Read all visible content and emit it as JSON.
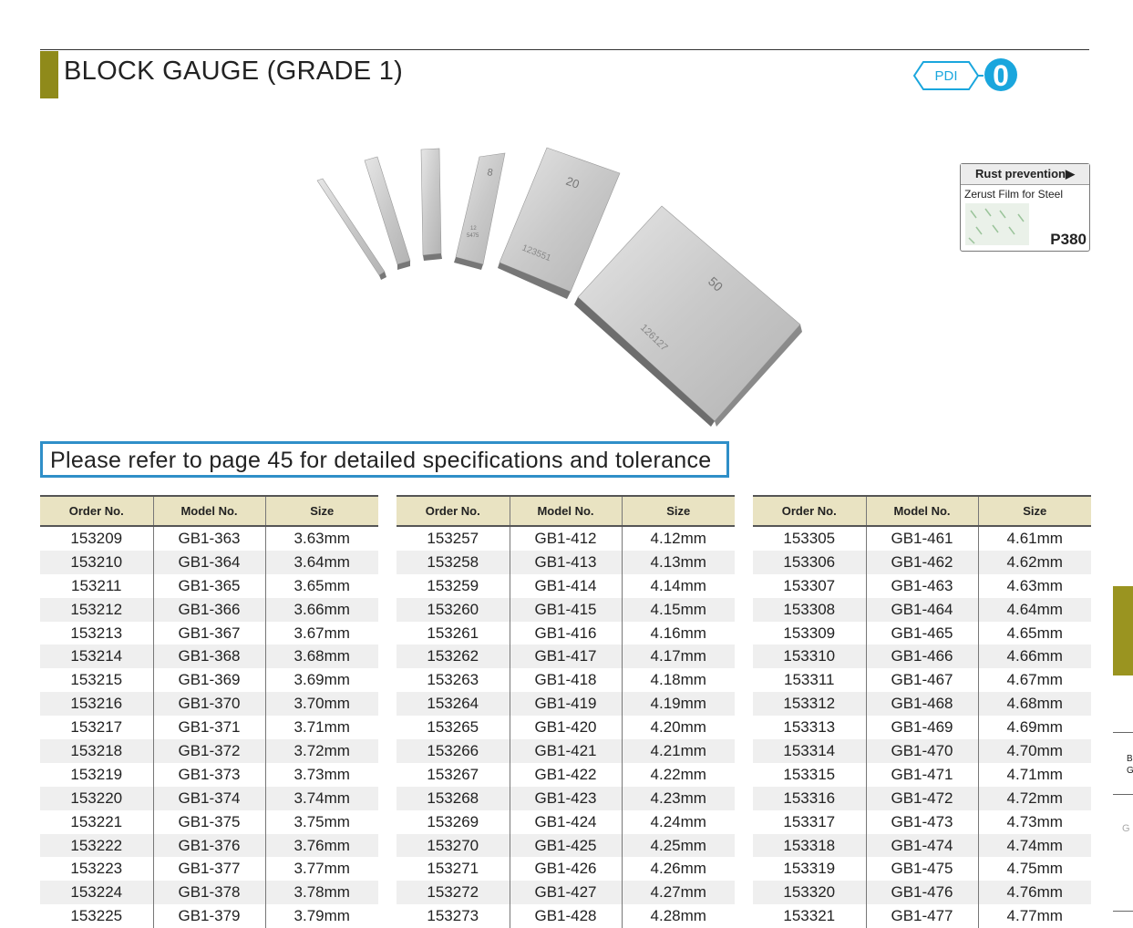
{
  "header": {
    "title": "BLOCK GAUGE (GRADE 1)",
    "pdi_label": "PDI",
    "circle_label": "0"
  },
  "product_image": {
    "block_labels": [
      "8",
      "12",
      "5475",
      "20",
      "123551",
      "50",
      "126127"
    ]
  },
  "rust_box": {
    "heading": "Rust prevention",
    "product": "Zerust Film for Steel",
    "code": "P380"
  },
  "note": "Please refer to page 45 for detailed specifications and tolerance",
  "table_headers": [
    "Order No.",
    "Model No.",
    "Size"
  ],
  "tables": [
    {
      "rows": [
        [
          "153209",
          "GB1-363",
          "3.63mm"
        ],
        [
          "153210",
          "GB1-364",
          "3.64mm"
        ],
        [
          "153211",
          "GB1-365",
          "3.65mm"
        ],
        [
          "153212",
          "GB1-366",
          "3.66mm"
        ],
        [
          "153213",
          "GB1-367",
          "3.67mm"
        ],
        [
          "153214",
          "GB1-368",
          "3.68mm"
        ],
        [
          "153215",
          "GB1-369",
          "3.69mm"
        ],
        [
          "153216",
          "GB1-370",
          "3.70mm"
        ],
        [
          "153217",
          "GB1-371",
          "3.71mm"
        ],
        [
          "153218",
          "GB1-372",
          "3.72mm"
        ],
        [
          "153219",
          "GB1-373",
          "3.73mm"
        ],
        [
          "153220",
          "GB1-374",
          "3.74mm"
        ],
        [
          "153221",
          "GB1-375",
          "3.75mm"
        ],
        [
          "153222",
          "GB1-376",
          "3.76mm"
        ],
        [
          "153223",
          "GB1-377",
          "3.77mm"
        ],
        [
          "153224",
          "GB1-378",
          "3.78mm"
        ],
        [
          "153225",
          "GB1-379",
          "3.79mm"
        ]
      ]
    },
    {
      "rows": [
        [
          "153257",
          "GB1-412",
          "4.12mm"
        ],
        [
          "153258",
          "GB1-413",
          "4.13mm"
        ],
        [
          "153259",
          "GB1-414",
          "4.14mm"
        ],
        [
          "153260",
          "GB1-415",
          "4.15mm"
        ],
        [
          "153261",
          "GB1-416",
          "4.16mm"
        ],
        [
          "153262",
          "GB1-417",
          "4.17mm"
        ],
        [
          "153263",
          "GB1-418",
          "4.18mm"
        ],
        [
          "153264",
          "GB1-419",
          "4.19mm"
        ],
        [
          "153265",
          "GB1-420",
          "4.20mm"
        ],
        [
          "153266",
          "GB1-421",
          "4.21mm"
        ],
        [
          "153267",
          "GB1-422",
          "4.22mm"
        ],
        [
          "153268",
          "GB1-423",
          "4.23mm"
        ],
        [
          "153269",
          "GB1-424",
          "4.24mm"
        ],
        [
          "153270",
          "GB1-425",
          "4.25mm"
        ],
        [
          "153271",
          "GB1-426",
          "4.26mm"
        ],
        [
          "153272",
          "GB1-427",
          "4.27mm"
        ],
        [
          "153273",
          "GB1-428",
          "4.28mm"
        ]
      ]
    },
    {
      "rows": [
        [
          "153305",
          "GB1-461",
          "4.61mm"
        ],
        [
          "153306",
          "GB1-462",
          "4.62mm"
        ],
        [
          "153307",
          "GB1-463",
          "4.63mm"
        ],
        [
          "153308",
          "GB1-464",
          "4.64mm"
        ],
        [
          "153309",
          "GB1-465",
          "4.65mm"
        ],
        [
          "153310",
          "GB1-466",
          "4.66mm"
        ],
        [
          "153311",
          "GB1-467",
          "4.67mm"
        ],
        [
          "153312",
          "GB1-468",
          "4.68mm"
        ],
        [
          "153313",
          "GB1-469",
          "4.69mm"
        ],
        [
          "153314",
          "GB1-470",
          "4.70mm"
        ],
        [
          "153315",
          "GB1-471",
          "4.71mm"
        ],
        [
          "153316",
          "GB1-472",
          "4.72mm"
        ],
        [
          "153317",
          "GB1-473",
          "4.73mm"
        ],
        [
          "153318",
          "GB1-474",
          "4.74mm"
        ],
        [
          "153319",
          "GB1-475",
          "4.75mm"
        ],
        [
          "153320",
          "GB1-476",
          "4.76mm"
        ],
        [
          "153321",
          "GB1-477",
          "4.77mm"
        ]
      ]
    }
  ],
  "side_nav": {
    "text1": "B",
    "text2": "G",
    "text3": "G"
  },
  "colors": {
    "accent_olive": "#8f8a1a",
    "note_border": "#2f8fc8",
    "pdi_blue": "#1aa6dd",
    "header_bg": "#e9e3c2"
  }
}
